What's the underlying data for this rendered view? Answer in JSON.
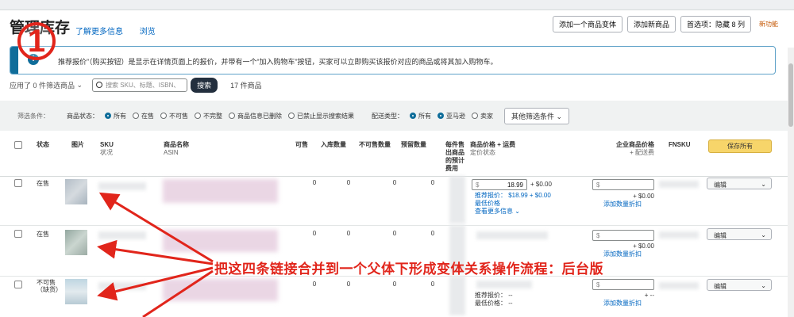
{
  "header": {
    "title": "管理库存",
    "link_learn": "了解更多信息",
    "link_tour": "浏览",
    "btn_add_variation": "添加一个商品变体",
    "btn_add_product": "添加新商品",
    "btn_preferences": "首选项：隐藏 8 列",
    "feedback": "新功能"
  },
  "annotation_number": "1",
  "banner": {
    "icon": "info-icon",
    "text": "推荐报价”（购买按钮）是显示在详情页面上的报价，并带有一个“加入购物车”按钮，买家可以立即购买该报价对应的商品或将其加入购物车。"
  },
  "filters": {
    "applied": "应用了 0 件筛选商品",
    "search_placeholder": "搜索 SKU、标题、ISBN、",
    "search_btn": "搜索",
    "count": "17 件商品"
  },
  "options": {
    "label": "筛选条件：",
    "status_label": "商品状态：",
    "status_opts": [
      "所有",
      "在售",
      "不可售",
      "不完整",
      "商品信息已删除",
      "已禁止显示搜索结果"
    ],
    "fulfill_label": "配送类型：",
    "fulfill_opts": [
      "所有",
      "亚马逊",
      "卖家"
    ],
    "more_btn": "其他筛选条件"
  },
  "columns": {
    "status": "状态",
    "image": "图片",
    "sku": "SKU",
    "sku_sub": "状况",
    "name": "商品名称",
    "asin": "ASIN",
    "available": "可售",
    "inbound": "入库数量",
    "unfulfillable": "不可售数量",
    "reserved": "预留数量",
    "est_fee": "每件售出商品的预计费用",
    "price": "商品价格 + 运费",
    "price_sub": "定价状态",
    "biz_price": "企业商品价格",
    "biz_sub": "+ 配送费",
    "fnsku": "FNSKU",
    "save_all": "保存所有"
  },
  "rows": [
    {
      "status": "在售",
      "q1": "0",
      "q2": "0",
      "q3": "0",
      "q4": "0",
      "price": "18.99",
      "currency": "$",
      "plus": "+ $0.00",
      "rec_line1": "推荐报价： $18.99 + $0.00",
      "rec_line2": "最低价格",
      "more": "查看更多信息",
      "biz_plus": "+ $0.00",
      "add_qty": "添加数量折扣",
      "action": "编辑"
    },
    {
      "status": "在售",
      "q1": "0",
      "q2": "0",
      "q3": "0",
      "q4": "0",
      "currency": "$",
      "biz_plus": "+ $0.00",
      "add_qty": "添加数量折扣",
      "action": "编辑"
    },
    {
      "status": "不可售（缺货）",
      "q1": "0",
      "q2": "0",
      "q3": "0",
      "q4": "0",
      "currency": "$",
      "rec_line1": "推荐报价： --",
      "rec_line2": "最低价格： --",
      "biz_plus": "+ --",
      "add_qty": "添加数量折扣",
      "action": "编辑"
    }
  ],
  "caption": "把这四条链接合并到一个父体下形成变体关系操作流程：后台版",
  "colors": {
    "accent": "#e1251b",
    "brand_teal": "#0f6d9a",
    "save_yellow": "#f7d56a"
  }
}
